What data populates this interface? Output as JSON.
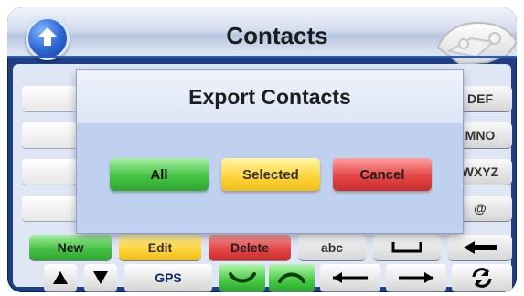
{
  "header": {
    "title": "Contacts"
  },
  "side_keys": {
    "k1": "DEF",
    "k2": "MNO",
    "k3": "WXYZ",
    "k4": "@"
  },
  "bottom_buttons": {
    "new": "New",
    "edit": "Edit",
    "delete": "Delete",
    "abc": "abc"
  },
  "nav": {
    "gps": "GPS"
  },
  "dialog": {
    "title": "Export Contacts",
    "all": "All",
    "selected": "Selected",
    "cancel": "Cancel"
  },
  "icons": [
    "up-arrow-icon",
    "phone-icon",
    "triangle-up-icon",
    "triangle-down-icon",
    "call-answer-icon",
    "call-hangup-icon",
    "arrow-left-icon",
    "arrow-right-icon",
    "refresh-icon",
    "backspace-icon",
    "space-icon"
  ]
}
